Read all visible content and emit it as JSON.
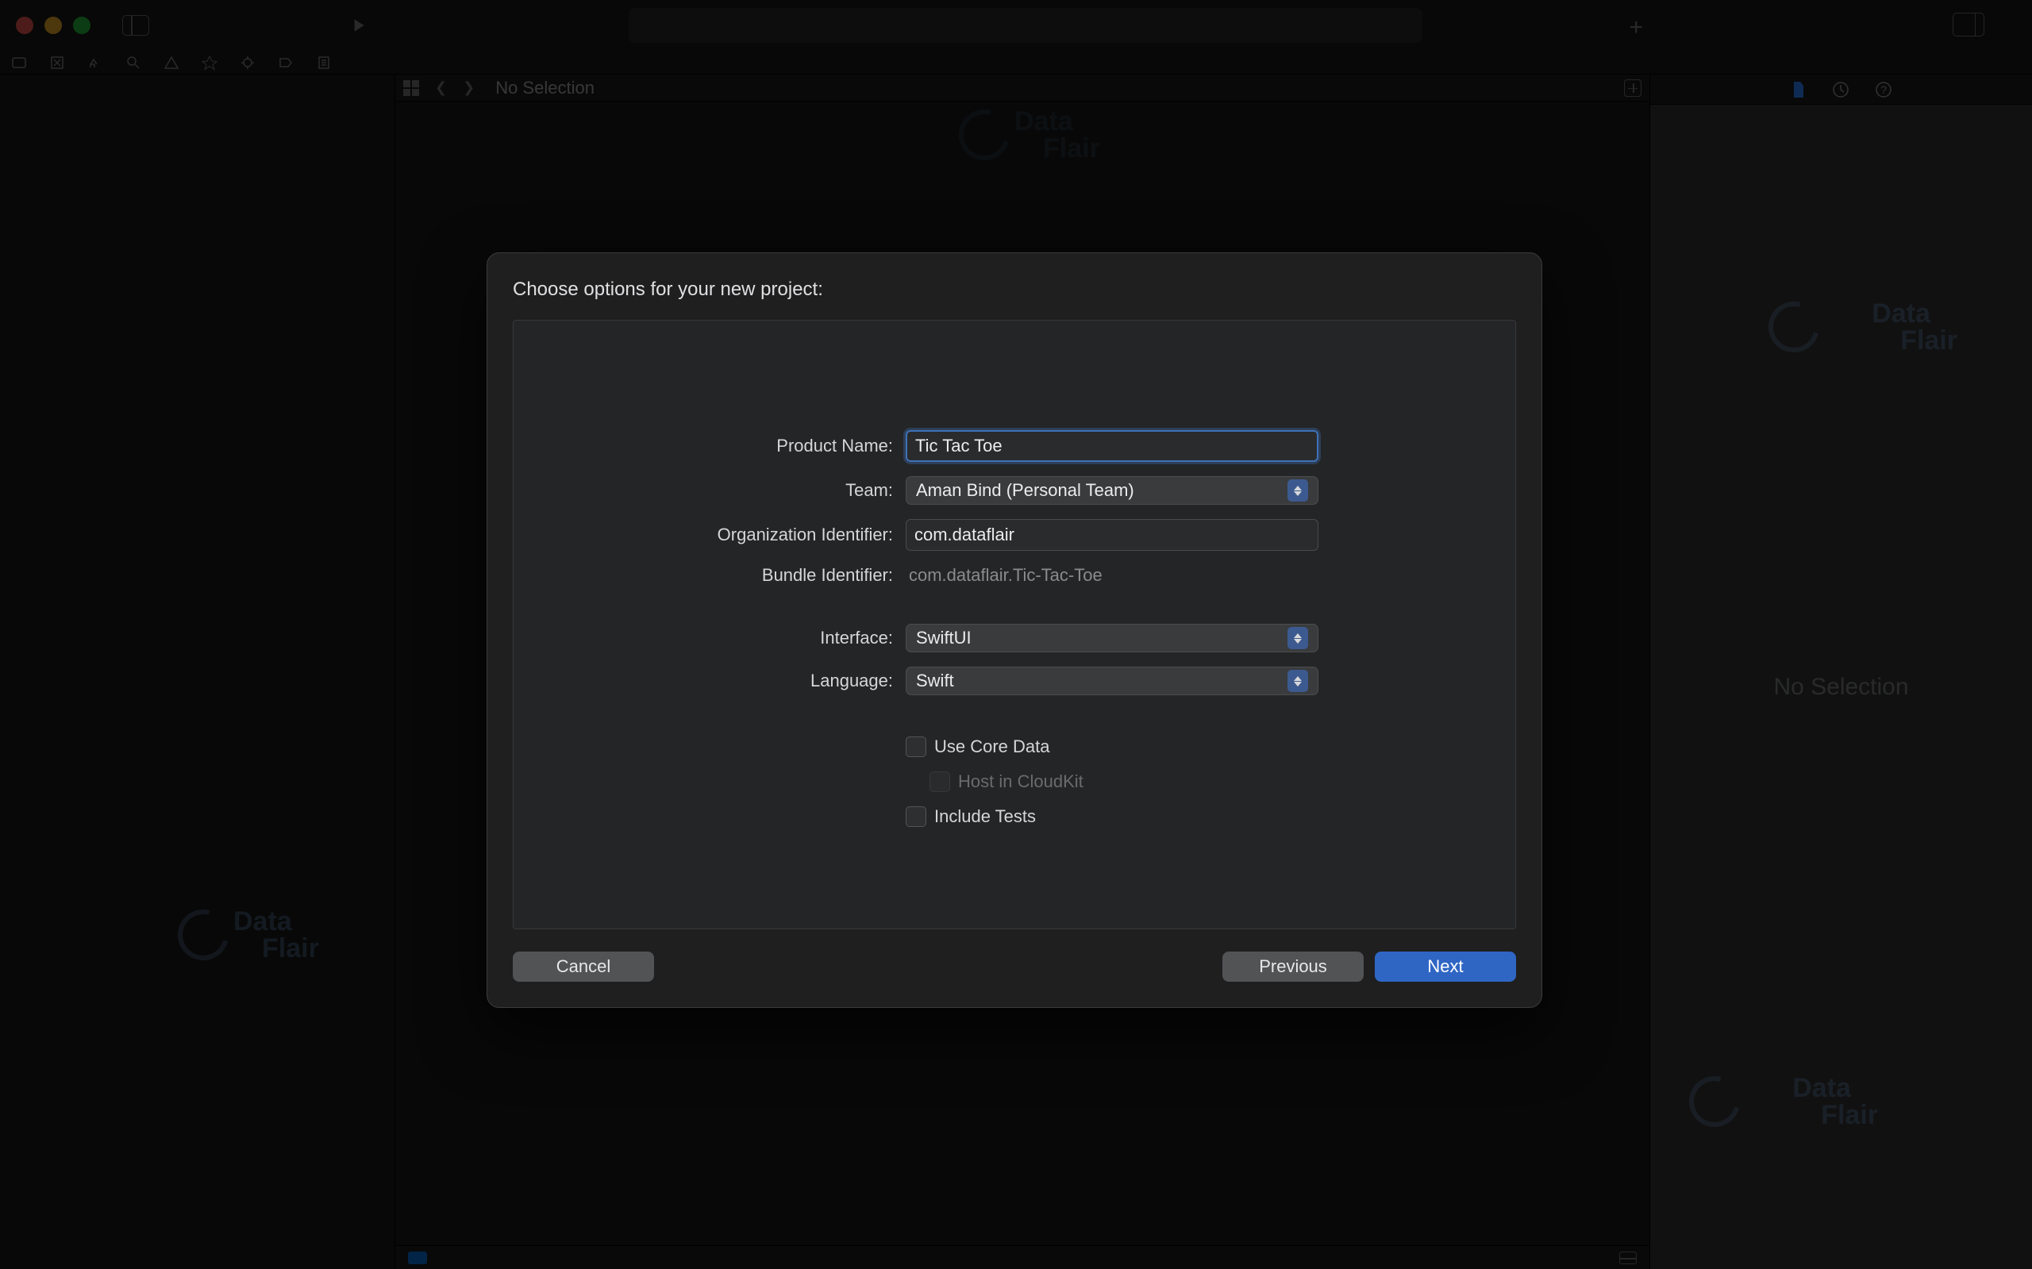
{
  "titlebar": {},
  "editor": {
    "no_selection": "No Selection"
  },
  "inspector": {
    "no_selection": "No Selection"
  },
  "watermark": {
    "line1": "Data",
    "line2": "Flair"
  },
  "sheet": {
    "title": "Choose options for your new project:",
    "labels": {
      "product_name": "Product Name:",
      "team": "Team:",
      "org_id": "Organization Identifier:",
      "bundle_id": "Bundle Identifier:",
      "interface": "Interface:",
      "language": "Language:"
    },
    "values": {
      "product_name": "Tic Tac Toe",
      "team": "Aman Bind (Personal Team)",
      "org_id": "com.dataflair",
      "bundle_id": "com.dataflair.Tic-Tac-Toe",
      "interface": "SwiftUI",
      "language": "Swift"
    },
    "checks": {
      "core_data": "Use Core Data",
      "cloudkit": "Host in CloudKit",
      "include_tests": "Include Tests"
    },
    "buttons": {
      "cancel": "Cancel",
      "previous": "Previous",
      "next": "Next"
    }
  }
}
